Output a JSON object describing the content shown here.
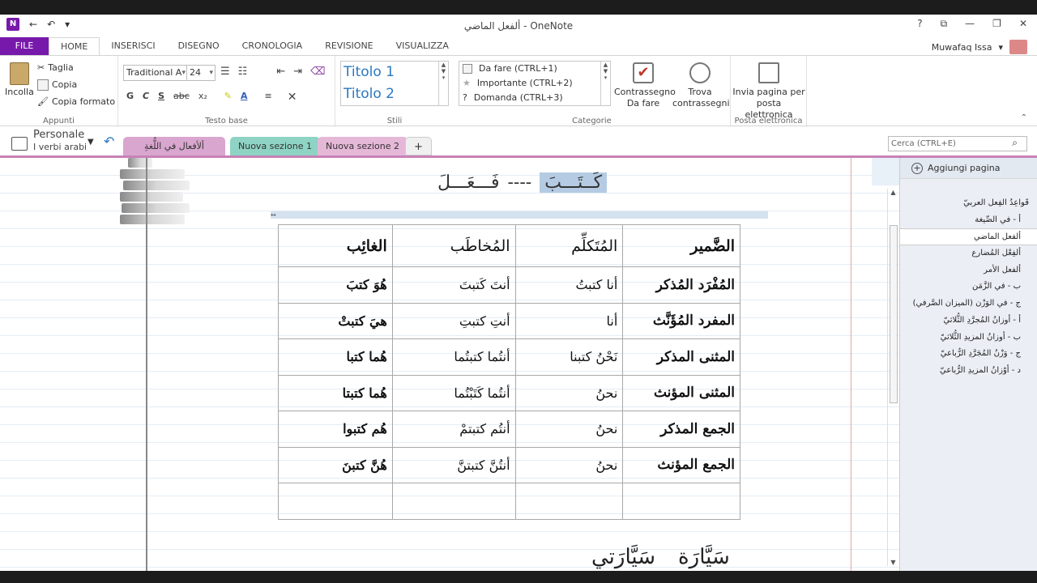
{
  "window": {
    "title": "ألفعل الماضي - OneNote",
    "help": "?",
    "restore": "⧉",
    "minimize": "—",
    "maximize": "❐",
    "close": "✕",
    "app_icon": "N",
    "quick_access_back": "←",
    "quick_access_undo": "↶",
    "quick_access_more": "▾"
  },
  "ribbon_tabs": {
    "file": "FILE",
    "home": "HOME",
    "insert": "INSERISCI",
    "draw": "DISEGNO",
    "history": "CRONOLOGIA",
    "review": "REVISIONE",
    "view": "VISUALIZZA"
  },
  "user": {
    "name": "Muwafaq Issa",
    "dropdown": "▾"
  },
  "clipboard": {
    "paste": "Incolla",
    "cut": "Taglia",
    "copy": "Copia",
    "format_painter": "Copia formato",
    "label": "Appunti"
  },
  "basic_text": {
    "font": "Traditional A",
    "size": "24",
    "bold": "G",
    "italic": "C",
    "underline": "S",
    "strike": "abc",
    "subscript": "x₂",
    "label": "Testo base"
  },
  "styles": {
    "title1": "Titolo 1",
    "title2": "Titolo 2",
    "label": "Stili"
  },
  "tags": {
    "items": [
      "Da fare (CTRL+1)",
      "Importante (CTRL+2)",
      "Domanda (CTRL+3)"
    ],
    "todo_tag": "Contrassegno Da fare",
    "find_tags": "Trova contrassegni",
    "label": "Categorie"
  },
  "email": {
    "send": "Invia pagina per posta elettronica",
    "label": "Posta elettronica"
  },
  "notebook": {
    "name": "Personale",
    "section_group": "I verbi arabi",
    "sections": [
      "ألأفعال في اللُّغةِ العَرَبيّة",
      "Nuova sezione 1",
      "Nuova sezione 2"
    ],
    "add_section": "+",
    "search_placeholder": "Cerca (CTRL+E)"
  },
  "canvas": {
    "verb": "كَــتَـــبَ",
    "dashes": "----",
    "pattern": "فَـــعَـــلَ",
    "table_handle": "↔",
    "table": {
      "header": [
        "الضَّمير",
        "المُتَكلِّم",
        "المُخاطَب",
        "الغائِب"
      ],
      "rows": [
        [
          "المُفْرَد المُذكر",
          "أنا كتبتُ",
          "أنتَ كَتبتَ",
          "هُوَ كتبَ"
        ],
        [
          "المفرد المُؤَنَّث",
          "أنا",
          "أنتِ كتبتِ",
          "هيَ كتبتْ"
        ],
        [
          "المثنى المذكر",
          "نَحْنُ كتبنا",
          "أنتُما كتبتُما",
          "هُما كتبا"
        ],
        [
          "المثنى المؤنث",
          "نحنُ",
          "أنتُما كَتَبْتُما",
          "هُما كتبتا"
        ],
        [
          "الجمع المذكر",
          "نحنُ",
          "أنتُم كتبتمْ",
          "هُم كتبوا"
        ],
        [
          "الجمع المؤنث",
          "نحنُ",
          "أنتُنَّ كتبتنَّ",
          "هُنَّ كتبنَ"
        ],
        [
          "",
          "",
          "",
          ""
        ]
      ]
    },
    "bottom_words": [
      "سَيَّارَة",
      "سَيَّارَتي"
    ]
  },
  "pages": {
    "add_page": "Aggiungi pagina",
    "items": [
      "قَواعِدُ الفِعل العربيّ",
      "أ - في الصِّيغة",
      "ألفعل الماضي",
      "ألفِعْل المُضارع",
      "ألفعل الأمر",
      "ب - في الزَّمَن",
      "ج - في الوَزْن (الميزان الصَّرفي)",
      "أ - أوزانُ المُجرَّدِ الثُّلاثيّ",
      "ب - أوزانُ المزيدِ الثُّلاثيّ",
      "ج - وَزْنُ المُجَرَّدِ الرُّباعيّ",
      "د - أوْزانُ المزيدِ الرُّباعيّ"
    ],
    "active_index": 2
  },
  "colors": {
    "accent": "#7719aa",
    "section_active": "#d9a6cf",
    "section2": "#8ed3c4",
    "section3": "#e6b8d8"
  }
}
